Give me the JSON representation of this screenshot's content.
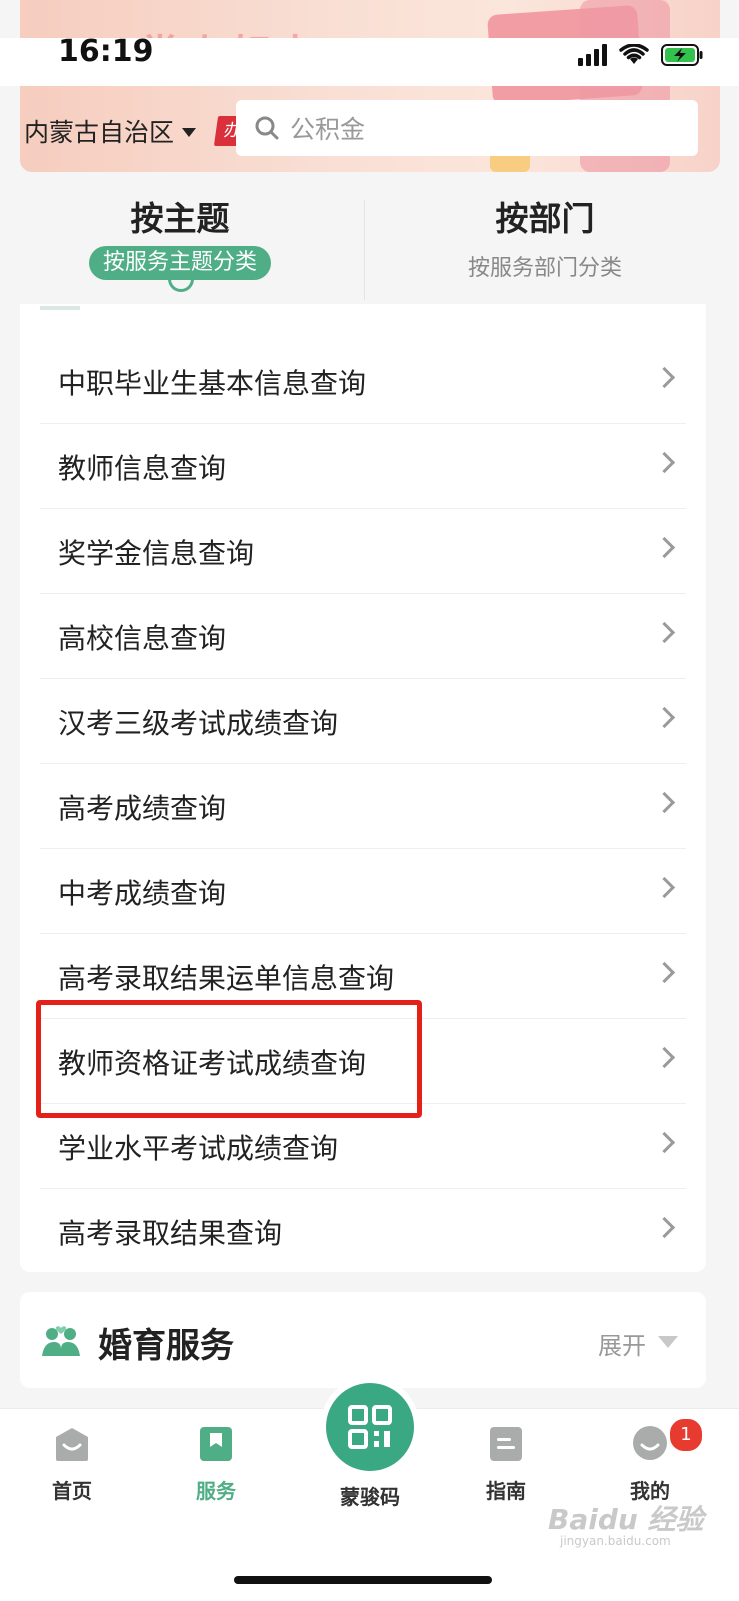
{
  "status_bar": {
    "time": "16:19"
  },
  "banner": {
    "tag": "办理"
  },
  "header": {
    "region": "内蒙古自治区",
    "search_placeholder": "公积金"
  },
  "tabs": [
    {
      "title": "按主题",
      "subtitle": "按服务主题分类",
      "active": true
    },
    {
      "title": "按部门",
      "subtitle": "按服务部门分类",
      "active": false
    }
  ],
  "list_items": [
    "中职毕业生基本信息查询",
    "教师信息查询",
    "奖学金信息查询",
    "高校信息查询",
    "汉考三级考试成绩查询",
    "高考成绩查询",
    "中考成绩查询",
    "高考录取结果运单信息查询",
    "教师资格证考试成绩查询",
    "学业水平考试成绩查询",
    "高考录取结果查询"
  ],
  "highlighted_item": "教师资格证考试成绩查询",
  "section": {
    "title": "婚育服务",
    "expand_label": "展开"
  },
  "bottom_nav": [
    {
      "label": "首页",
      "icon": "home-icon"
    },
    {
      "label": "服务",
      "icon": "bookmark-icon",
      "active": true
    },
    {
      "label": "蒙骏码",
      "icon": "qr-code-icon"
    },
    {
      "label": "指南",
      "icon": "guide-icon"
    },
    {
      "label": "我的",
      "icon": "profile-icon",
      "badge": "1"
    }
  ],
  "colors": {
    "accent": "#4fae86",
    "highlight": "#e52019",
    "badge": "#e63b2e"
  },
  "watermark": "Baidu 经验",
  "watermark_sub": "jingyan.baidu.com"
}
